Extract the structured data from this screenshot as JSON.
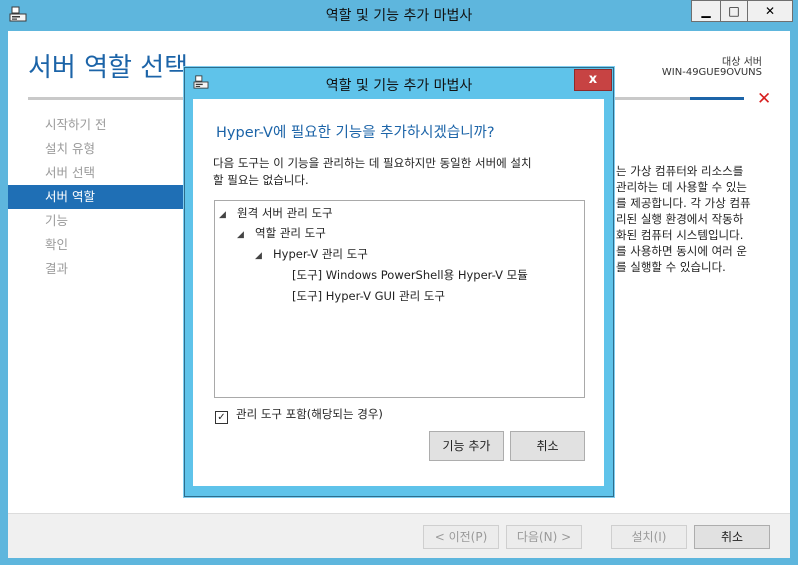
{
  "window": {
    "title": "역할 및 기능 추가 마법사",
    "min_glyph": "▁",
    "max_glyph": "□",
    "close_glyph": "✕"
  },
  "page": {
    "title": "서버 역할 선택",
    "destination_label": "대상 서버",
    "destination_server": "WIN-49GUE9OVUNS",
    "close_glyph": "✕"
  },
  "nav": {
    "items": [
      {
        "label": "시작하기 전",
        "active": false
      },
      {
        "label": "설치 유형",
        "active": false
      },
      {
        "label": "서버 선택",
        "active": false
      },
      {
        "label": "서버 역할",
        "active": true
      },
      {
        "label": "기능",
        "active": false
      },
      {
        "label": "확인",
        "active": false
      },
      {
        "label": "결과",
        "active": false
      }
    ]
  },
  "description": {
    "lines": [
      "는 가상 컴퓨터와 리소스를",
      "관리하는 데 사용할 수 있는",
      "를 제공합니다. 각 가상 컴퓨",
      "리된 실행 환경에서 작동하",
      "화된 컴퓨터 시스템입니다.",
      "를 사용하면 동시에 여러 운",
      "를 실행할 수 있습니다."
    ]
  },
  "footer": {
    "prev": "< 이전(P)",
    "next": "다음(N) >",
    "install": "설치(I)",
    "cancel": "취소"
  },
  "dialog": {
    "title": "역할 및 기능 추가 마법사",
    "close_glyph": "x",
    "heading": "Hyper-V에 필요한 기능을 추가하시겠습니까?",
    "text_line1": "다음 도구는 이 기능을 관리하는 데 필요하지만 동일한 서버에 설치",
    "text_line2": "할 필요는 없습니다.",
    "tree": [
      {
        "label": "원격 서버 관리 도구",
        "expanded": true
      },
      {
        "label": "역할 관리 도구",
        "expanded": true
      },
      {
        "label": "Hyper-V 관리 도구",
        "expanded": true
      },
      {
        "label": "[도구] Windows PowerShell용 Hyper-V 모듈",
        "expanded": false
      },
      {
        "label": "[도구] Hyper-V GUI 관리 도구",
        "expanded": false
      }
    ],
    "expand_glyph": "◢",
    "include_checked": true,
    "check_glyph": "✓",
    "include_label": "관리 도구 포함(해당되는 경우)",
    "add_button": "기능 추가",
    "cancel_button": "취소"
  }
}
